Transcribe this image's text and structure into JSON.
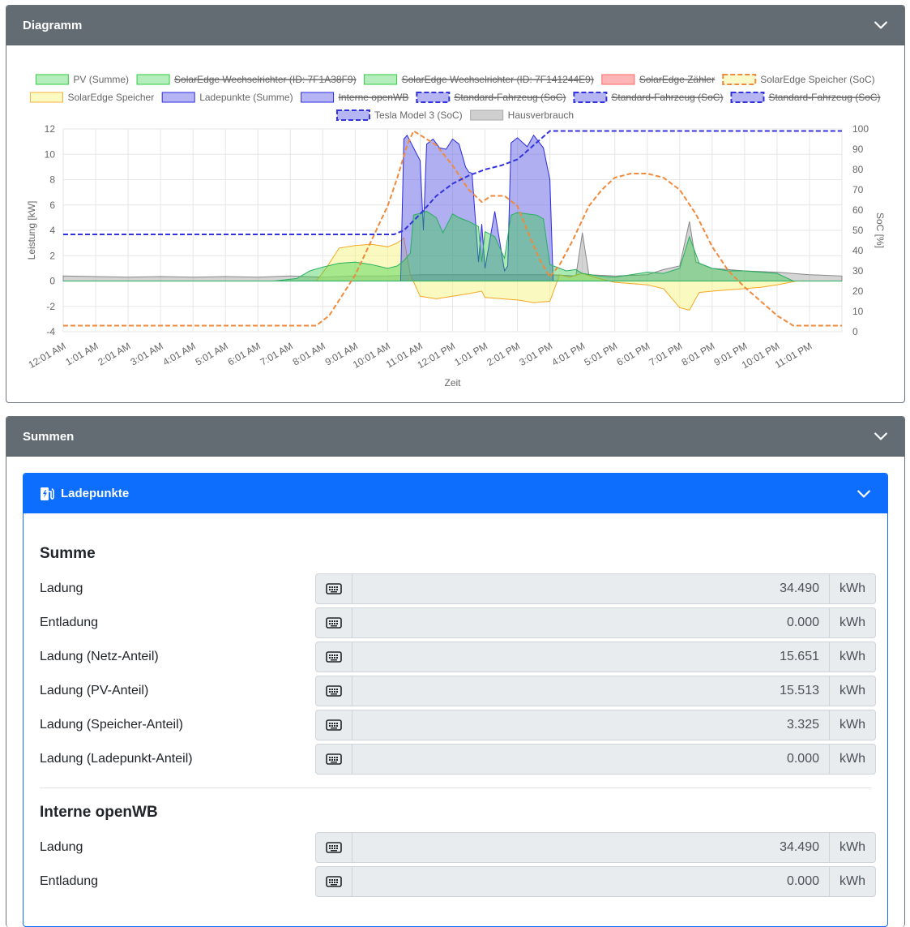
{
  "diagram": {
    "title": "Diagramm",
    "colors": {
      "pv": "#2ecc40",
      "pv_fill": "rgba(46,204,64,0.35)",
      "lp": "#2b2be0",
      "lp_fill": "rgba(80,80,230,0.45)",
      "speicher": "#f39c12",
      "speicher_fill": "rgba(245,245,120,0.45)",
      "soc_speicher": "#f08a3c",
      "soc_tesla": "#3333dd",
      "haus_fill": "rgba(150,150,150,0.45)",
      "haus": "#777777",
      "zaehler": "#ff6666"
    }
  },
  "chart_data": {
    "type": "area",
    "ylabel_left": "Leistung [kW]",
    "ylabel_right": "SoC [%]",
    "xlabel": "Zeit",
    "ylim_left": [
      -4,
      12
    ],
    "ylim_right": [
      0,
      100
    ],
    "yticks_left": [
      "12",
      "10",
      "8",
      "6",
      "4",
      "2",
      "0",
      "-2",
      "-4"
    ],
    "yticks_right": [
      "100",
      "90",
      "80",
      "70",
      "60",
      "50",
      "40",
      "30",
      "20",
      "10",
      "0"
    ],
    "x_ticks": [
      "12:01 AM",
      "1:01 AM",
      "2:01 AM",
      "3:01 AM",
      "4:01 AM",
      "5:01 AM",
      "6:01 AM",
      "7:01 AM",
      "8:01 AM",
      "9:01 AM",
      "10:01 AM",
      "11:01 AM",
      "12:01 PM",
      "1:01 PM",
      "2:01 PM",
      "3:01 PM",
      "4:01 PM",
      "5:01 PM",
      "6:01 PM",
      "7:01 PM",
      "8:01 PM",
      "9:01 PM",
      "10:01 PM",
      "11:01 PM"
    ],
    "grid": true,
    "legend_position": "top",
    "legend": [
      {
        "label": "PV (Summe)",
        "kind": "pv",
        "hidden": false
      },
      {
        "label": "SolarEdge Wechselrichter (ID: 7F1A38F9)",
        "kind": "pv",
        "hidden": true
      },
      {
        "label": "SolarEdge Wechselrichter (ID: 7F141244E9)",
        "kind": "pv",
        "hidden": true
      },
      {
        "label": "SolarEdge Zähler",
        "kind": "zaehler",
        "hidden": true
      },
      {
        "label": "SolarEdge Speicher (SoC)",
        "kind": "soc_speicher",
        "hidden": false
      },
      {
        "label": "SolarEdge Speicher",
        "kind": "speicher",
        "hidden": false
      },
      {
        "label": "Ladepunkte (Summe)",
        "kind": "lp",
        "hidden": false
      },
      {
        "label": "Interne openWB",
        "kind": "lp",
        "hidden": true
      },
      {
        "label": "Standard-Fahrzeug (SoC)",
        "kind": "soc_tesla",
        "hidden": true
      },
      {
        "label": "Standard-Fahrzeug (SoC)",
        "kind": "soc_tesla",
        "hidden": true
      },
      {
        "label": "Standard-Fahrzeug (SoC)",
        "kind": "soc_tesla",
        "hidden": true
      },
      {
        "label": "Tesla Model 3 (SoC)",
        "kind": "soc_tesla",
        "hidden": false
      },
      {
        "label": "Hausverbrauch",
        "kind": "haus",
        "hidden": false
      }
    ],
    "series": [
      {
        "name": "PV (Summe)",
        "unit": "kW",
        "x": [
          0,
          6.5,
          7.2,
          7.6,
          8.0,
          8.5,
          9.0,
          9.5,
          10.0,
          10.3,
          10.5,
          10.7,
          10.8,
          11.2,
          11.5,
          11.7,
          12.0,
          12.2,
          12.5,
          12.8,
          12.9,
          13.0,
          13.3,
          13.6,
          13.8,
          14.0,
          14.3,
          14.6,
          14.8,
          15.0,
          15.3,
          15.5,
          15.8,
          16.0,
          16.5,
          17.0,
          17.5,
          18.0,
          18.5,
          19.0,
          19.3,
          19.6,
          20.0,
          20.5,
          21.0,
          21.5,
          22.0,
          22.5,
          24.0
        ],
        "y": [
          0,
          0,
          0.2,
          0.8,
          1.1,
          1.4,
          1.5,
          1.3,
          1.0,
          1.2,
          1.6,
          2.2,
          5.2,
          5.5,
          5.0,
          3.8,
          5.3,
          5.0,
          4.7,
          4.3,
          1.5,
          3.9,
          3.5,
          1.8,
          5.2,
          5.4,
          5.3,
          5.2,
          4.9,
          1.3,
          1.0,
          0.8,
          0.9,
          0.6,
          0.4,
          0.3,
          0.5,
          0.7,
          0.6,
          1.0,
          3.5,
          1.4,
          1.0,
          0.8,
          0.8,
          0.7,
          0.6,
          0,
          0
        ]
      },
      {
        "name": "Ladepunkte (Summe)",
        "unit": "kW",
        "x": [
          0,
          10.4,
          10.5,
          10.6,
          10.8,
          11.0,
          11.1,
          11.2,
          11.4,
          11.6,
          11.8,
          12.0,
          12.2,
          12.4,
          12.5,
          12.6,
          12.8,
          12.9,
          13.0,
          13.3,
          13.6,
          13.7,
          13.8,
          14.0,
          14.3,
          14.5,
          14.8,
          15.0,
          15.1,
          24.0
        ],
        "y": [
          0,
          0,
          11.2,
          11.5,
          10.5,
          9.5,
          4.0,
          10.8,
          11.2,
          10.5,
          10.4,
          11.2,
          10.8,
          9.0,
          8.6,
          8.5,
          1.5,
          4.5,
          1.0,
          5.5,
          0.8,
          1.2,
          10.9,
          11.3,
          10.6,
          11.5,
          10.5,
          8.0,
          0,
          0
        ]
      },
      {
        "name": "SolarEdge Speicher",
        "unit": "kW",
        "x": [
          0,
          7.8,
          8.1,
          8.5,
          9.0,
          9.5,
          10.0,
          10.3,
          10.5,
          10.7,
          11.0,
          11.5,
          12.0,
          12.5,
          12.9,
          13.0,
          13.5,
          14.0,
          14.5,
          15.0,
          15.3,
          15.6,
          16.0,
          16.5,
          17.0,
          17.5,
          18.0,
          18.5,
          19.0,
          19.3,
          19.6,
          20.0,
          20.5,
          21.0,
          21.5,
          22.0,
          22.6,
          24.0
        ],
        "y": [
          0,
          0,
          1.0,
          2.6,
          2.8,
          2.9,
          2.7,
          3.0,
          3.4,
          0.5,
          -1.2,
          -1.4,
          -1.2,
          -1.0,
          -0.8,
          -1.3,
          -1.4,
          -1.5,
          -1.7,
          -1.6,
          0.5,
          0.3,
          0.6,
          0.2,
          -0.1,
          -0.2,
          -0.3,
          -0.6,
          -2.1,
          -2.3,
          -0.9,
          -0.8,
          -0.7,
          -0.6,
          -0.5,
          -0.3,
          0,
          0
        ]
      },
      {
        "name": "Hausverbrauch",
        "unit": "kW",
        "x": [
          0,
          1,
          2,
          3,
          4,
          5,
          6,
          7,
          8,
          9,
          10,
          11,
          12,
          13,
          14,
          15,
          15.8,
          16.0,
          16.2,
          17,
          18,
          18.5,
          19.0,
          19.3,
          19.5,
          20,
          21,
          22,
          23,
          24
        ],
        "y": [
          0.4,
          0.35,
          0.3,
          0.35,
          0.3,
          0.35,
          0.3,
          0.4,
          0.3,
          0.4,
          0.4,
          0.5,
          0.5,
          0.5,
          0.5,
          0.5,
          0.4,
          3.8,
          0.5,
          0.4,
          0.5,
          0.9,
          1.2,
          4.7,
          1.5,
          1.0,
          0.8,
          0.7,
          0.5,
          0.4
        ]
      },
      {
        "name": "SolarEdge Speicher (SoC)",
        "unit": "%",
        "x": [
          0,
          7.8,
          8.2,
          8.6,
          9.0,
          9.5,
          10.0,
          10.3,
          10.6,
          10.8,
          11.0,
          11.5,
          12.0,
          12.5,
          12.9,
          13.2,
          13.6,
          14.0,
          14.3,
          14.7,
          15.0,
          15.3,
          15.7,
          16.2,
          16.6,
          17.0,
          17.5,
          18.0,
          18.5,
          19.0,
          19.5,
          20.0,
          20.5,
          21.0,
          21.5,
          22.0,
          22.5,
          24.0
        ],
        "y": [
          3,
          3,
          8,
          18,
          28,
          45,
          62,
          76,
          92,
          99,
          97,
          92,
          82,
          70,
          64,
          67,
          67,
          62,
          50,
          35,
          27,
          33,
          45,
          62,
          70,
          76,
          78,
          78,
          76,
          70,
          58,
          42,
          30,
          22,
          15,
          8,
          3,
          3
        ]
      },
      {
        "name": "Tesla Model 3 (SoC)",
        "unit": "%",
        "x": [
          0,
          10.2,
          10.5,
          11.0,
          11.5,
          12.0,
          12.5,
          13.0,
          13.5,
          14.0,
          14.5,
          15.0,
          24.0
        ],
        "y": [
          48,
          48,
          50,
          58,
          67,
          73,
          77,
          80,
          82,
          85,
          92,
          99,
          99
        ]
      }
    ]
  },
  "summen": {
    "title": "Summen",
    "ladepunkte": {
      "title": "Ladepunkte",
      "sections": [
        {
          "title": "Summe",
          "rows": [
            {
              "label": "Ladung",
              "value": "34.490",
              "unit": "kWh"
            },
            {
              "label": "Entladung",
              "value": "0.000",
              "unit": "kWh"
            },
            {
              "label": "Ladung (Netz-Anteil)",
              "value": "15.651",
              "unit": "kWh"
            },
            {
              "label": "Ladung (PV-Anteil)",
              "value": "15.513",
              "unit": "kWh"
            },
            {
              "label": "Ladung (Speicher-Anteil)",
              "value": "3.325",
              "unit": "kWh"
            },
            {
              "label": "Ladung (Ladepunkt-Anteil)",
              "value": "0.000",
              "unit": "kWh"
            }
          ]
        },
        {
          "title": "Interne openWB",
          "rows": [
            {
              "label": "Ladung",
              "value": "34.490",
              "unit": "kWh"
            },
            {
              "label": "Entladung",
              "value": "0.000",
              "unit": "kWh"
            }
          ]
        }
      ]
    }
  }
}
